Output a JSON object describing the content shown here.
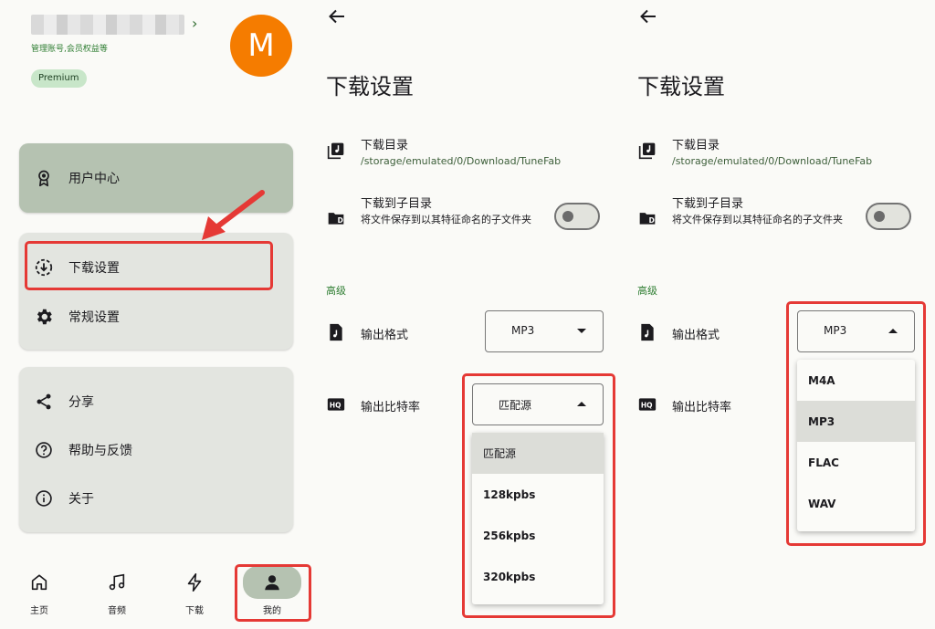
{
  "account": {
    "subtitle": "管理账号,会员权益等",
    "avatar_letter": "M",
    "badge": "Premium"
  },
  "menu_cards": {
    "card1": [
      {
        "label": "用户中心",
        "icon": "award-icon"
      }
    ],
    "card2": [
      {
        "label": "下载设置",
        "icon": "download-settings-icon"
      },
      {
        "label": "常规设置",
        "icon": "gear-icon"
      }
    ],
    "card3": [
      {
        "label": "分享",
        "icon": "share-icon"
      },
      {
        "label": "帮助与反馈",
        "icon": "help-icon"
      },
      {
        "label": "关于",
        "icon": "info-icon"
      }
    ]
  },
  "bottom_nav": [
    {
      "label": "主页",
      "icon": "home-icon"
    },
    {
      "label": "音频",
      "icon": "music-note-icon"
    },
    {
      "label": "下载",
      "icon": "lightning-icon"
    },
    {
      "label": "我的",
      "icon": "person-icon",
      "active": true
    }
  ],
  "download_settings": {
    "title": "下载设置",
    "dir_label": "下载目录",
    "dir_path": "/storage/emulated/0/Download/TuneFab",
    "subdir_label": "下载到子目录",
    "subdir_desc": "将文件保存到以其特征命名的子文件夹",
    "subdir_enabled": false,
    "advanced_label": "高级",
    "format_label": "输出格式",
    "format_value": "MP3",
    "bitrate_label": "输出比特率",
    "bitrate_value": "匹配源",
    "bitrate_options": [
      "匹配源",
      "128kpbs",
      "256kpbs",
      "320kpbs"
    ],
    "format_options": [
      "M4A",
      "MP3",
      "FLAC",
      "WAV"
    ]
  },
  "colors": {
    "highlight": "#e53935",
    "accent_green": "#2e7d32",
    "avatar": "#f57c00",
    "card_green": "#b5c2b1"
  }
}
